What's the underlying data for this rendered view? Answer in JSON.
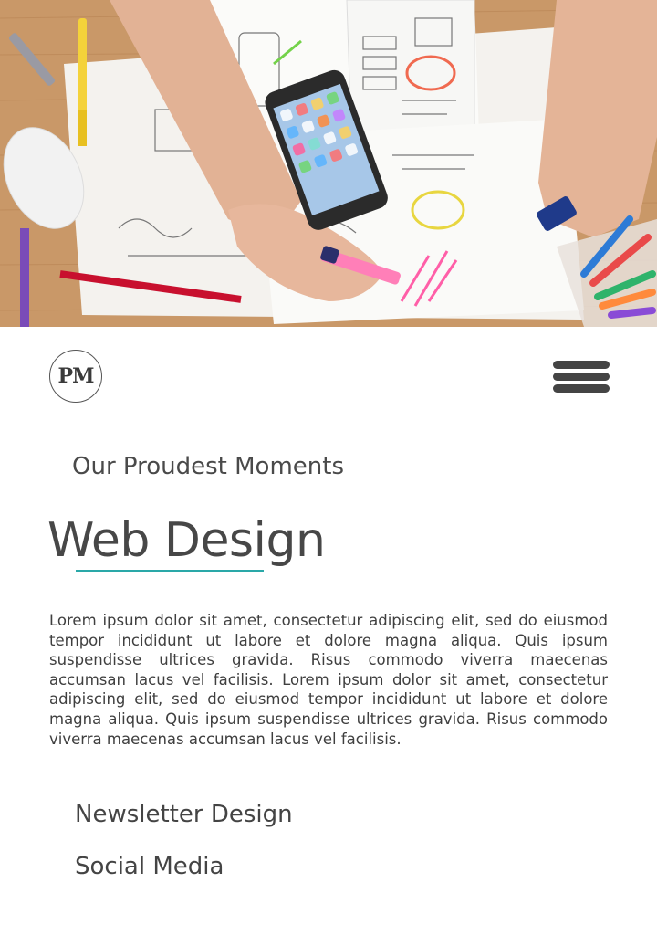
{
  "header": {
    "logo_text": "PM",
    "menu_icon": "hamburger-menu-icon"
  },
  "hero": {
    "image_description_icon": "desk-workspace-photo"
  },
  "section": {
    "subtitle": "Our Proudest Moments",
    "title": "Web Design",
    "body": "Lorem ipsum dolor sit amet, consectetur adipiscing elit, sed do eiusmod tempor incididunt ut labore et dolore magna aliqua. Quis ipsum suspendisse ultrices gravida. Risus commodo viverra maecenas accumsan lacus vel facilisis. Lorem ipsum dolor sit amet, consectetur adipiscing elit, sed do eiusmod tempor incididunt ut labore et dolore magna aliqua. Quis ipsum suspendisse ultrices gravida. Risus commodo viverra maecenas accumsan lacus vel facilisis."
  },
  "links": [
    {
      "label": "Newsletter Design"
    },
    {
      "label": "Social Media"
    }
  ],
  "colors": {
    "accent": "#2aa8a8",
    "text": "#444444",
    "background": "#ffffff"
  }
}
